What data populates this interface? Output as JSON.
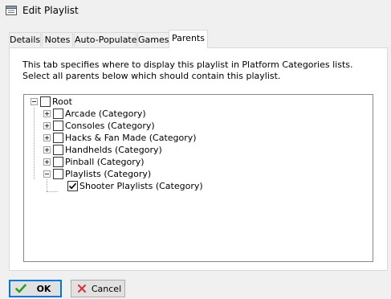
{
  "window": {
    "title": "Edit Playlist",
    "icon": "window-app-icon"
  },
  "tabs": [
    {
      "label": "Details",
      "active": false
    },
    {
      "label": "Notes",
      "active": false
    },
    {
      "label": "Auto-Populate",
      "active": false
    },
    {
      "label": "Games",
      "active": false
    },
    {
      "label": "Parents",
      "active": true
    }
  ],
  "parents_tab": {
    "description": "This tab specifies where to display this playlist in Platform Categories lists. Select all parents below which should contain this playlist.",
    "tree": [
      {
        "label": "Root",
        "level": 0,
        "expander": "minus",
        "checked": false
      },
      {
        "label": "Arcade (Category)",
        "level": 1,
        "expander": "plus",
        "checked": false
      },
      {
        "label": "Consoles (Category)",
        "level": 1,
        "expander": "plus",
        "checked": false
      },
      {
        "label": "Hacks & Fan Made (Category)",
        "level": 1,
        "expander": "plus",
        "checked": false
      },
      {
        "label": "Handhelds (Category)",
        "level": 1,
        "expander": "plus",
        "checked": false
      },
      {
        "label": "Pinball (Category)",
        "level": 1,
        "expander": "plus",
        "checked": false
      },
      {
        "label": "Playlists (Category)",
        "level": 1,
        "expander": "minus",
        "checked": false
      },
      {
        "label": "Shooter Playlists (Category)",
        "level": 2,
        "expander": "none",
        "checked": true
      }
    ]
  },
  "buttons": {
    "ok_label": "OK",
    "cancel_label": "Cancel"
  },
  "colors": {
    "ok_check": "#2e9c2e",
    "cancel_x": "#d13438",
    "default_button_border": "#0078d7"
  }
}
